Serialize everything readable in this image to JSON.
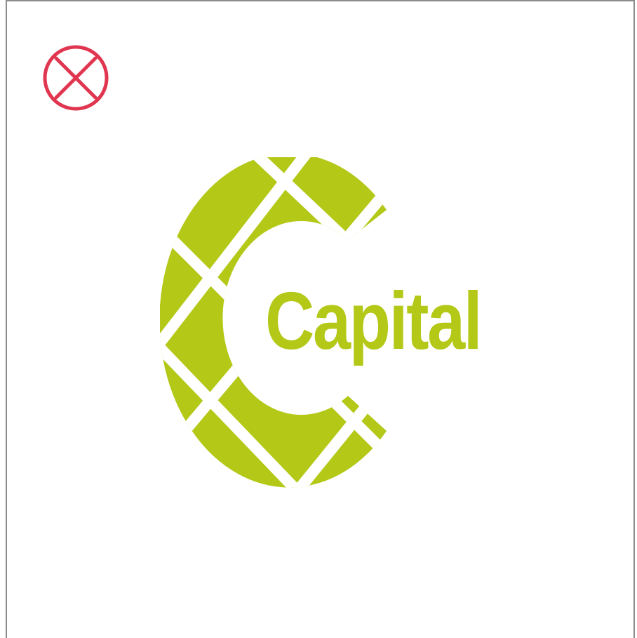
{
  "window": {
    "close_icon": "close-circle-x-icon"
  },
  "logo": {
    "wordmark": "Capital",
    "icon": "capital-c-segmented-logo"
  },
  "colors": {
    "brand_green": "#b4c817",
    "close_red": "#e0364f",
    "frame_gray": "#8c8c8c",
    "background": "#ffffff"
  }
}
